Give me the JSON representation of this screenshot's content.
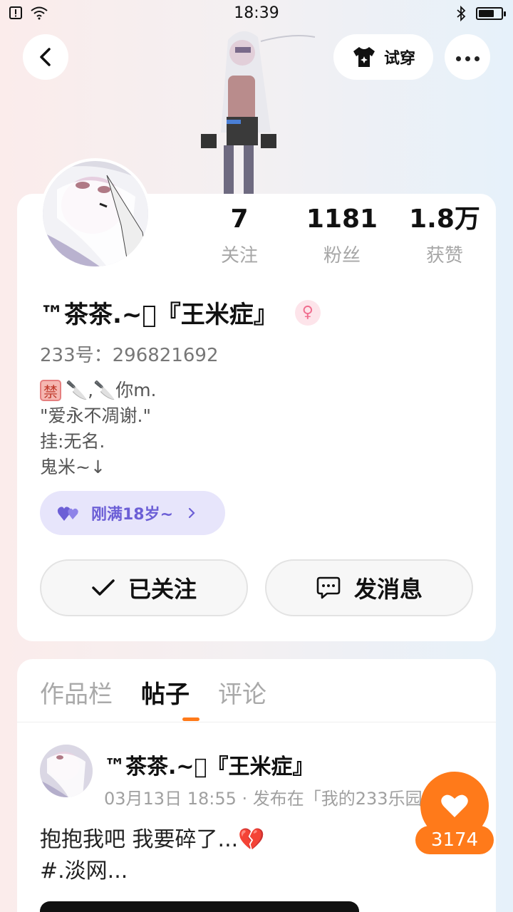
{
  "status_bar": {
    "time": "18:39",
    "battery_level": 0.7
  },
  "header": {
    "try_on_label": "试穿"
  },
  "profile": {
    "stats": [
      {
        "value": "7",
        "label": "关注"
      },
      {
        "value": "1181",
        "label": "粉丝"
      },
      {
        "value": "1.8万",
        "label": "获赞"
      }
    ],
    "username": "™茶茶.~\u0000『王米症』",
    "uid": "233号：296821692",
    "bio": {
      "line1_suffix": "🔪,🔪你m.",
      "line2": "\"爱永不凋谢.\"",
      "line3": "挂:无名.",
      "line4": "鬼米~↓"
    },
    "age_pill_label": "刚满18岁~",
    "follow_label": "已关注",
    "message_label": "发消息"
  },
  "content": {
    "tabs": [
      "作品栏",
      "帖子",
      "评论"
    ],
    "active_tab": 1,
    "post": {
      "author": "™茶茶.~\u0000『王米症』",
      "meta": "03月13日 18:55 · 发布在「我的233乐园」",
      "text_line1": "抱抱我吧  我要碎了...💔",
      "text_line2": "#.淡网..."
    }
  },
  "like_fab": {
    "count": "3174"
  },
  "colors": {
    "accent": "#ff7a1a",
    "pill_bg": "#e7e5fb",
    "pill_text": "#6c5fd6"
  }
}
